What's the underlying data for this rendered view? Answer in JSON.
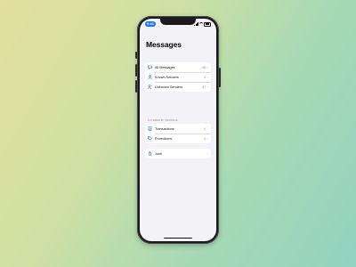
{
  "status": {
    "time": "9:41"
  },
  "title": "Messages",
  "filters": [
    {
      "label": "All Messages",
      "count": "48",
      "icon": "bubble-icon"
    },
    {
      "label": "Known Senders",
      "count": "9",
      "icon": "person-icon"
    },
    {
      "label": "Unknown Senders",
      "count": "37",
      "icon": "person-question-icon"
    }
  ],
  "section_header": "FILTERED BY MESSAGE",
  "filtered": [
    {
      "label": "Transactions",
      "count": "4",
      "icon": "receipt-icon"
    },
    {
      "label": "Promotions",
      "count": "0",
      "icon": "tag-icon"
    }
  ],
  "junk": {
    "label": "Junk",
    "icon": "trash-icon"
  },
  "colors": {
    "accent": "#1a73e8",
    "background": "#f2f2f7"
  }
}
